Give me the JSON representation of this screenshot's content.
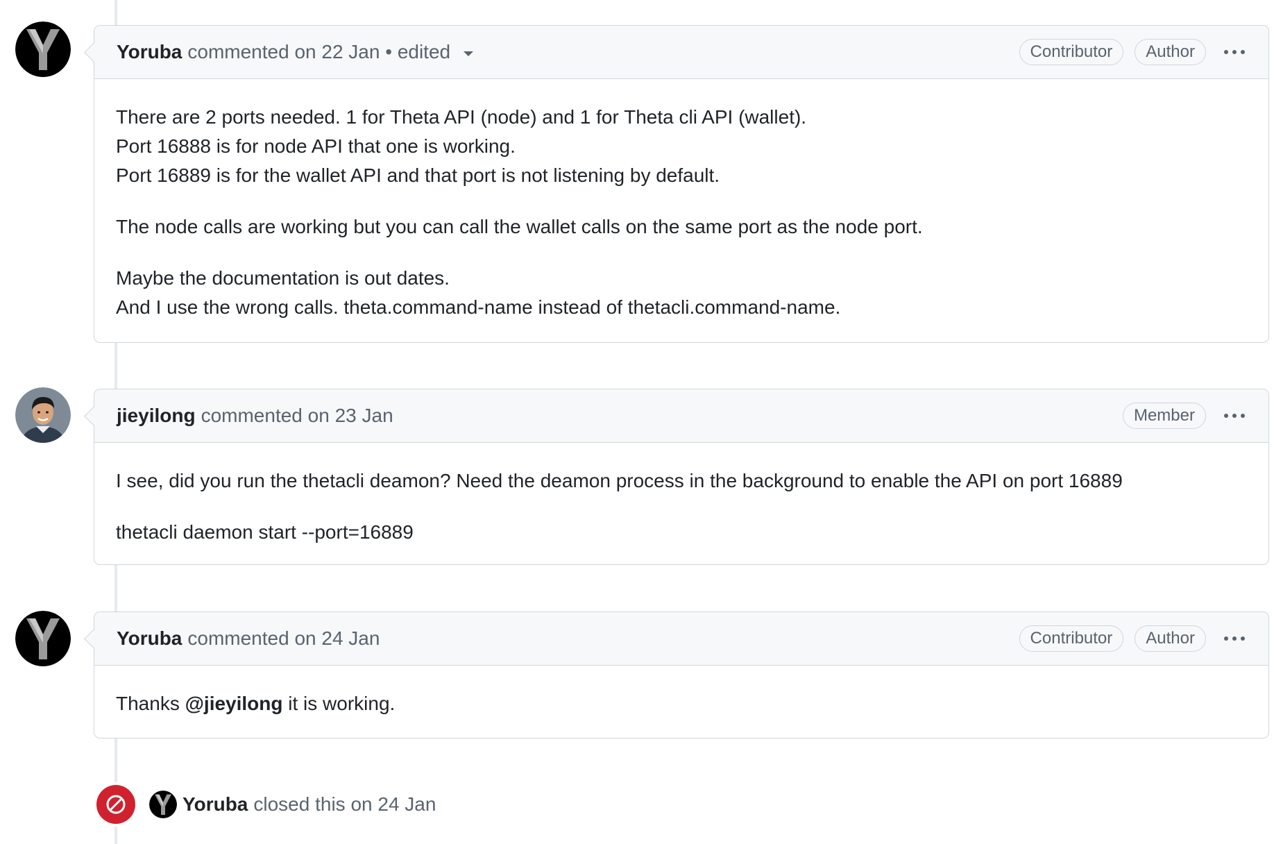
{
  "comments": [
    {
      "author": "Yoruba",
      "meta": "commented on 22 Jan • edited",
      "badges": [
        "Contributor",
        "Author"
      ],
      "avatar_icon": "yoruba-y-logo-icon",
      "paragraphs": [
        [
          "There are 2 ports needed. 1 for Theta API (node) and 1 for Theta cli API (wallet).",
          "Port 16888 is for node API that one is working.",
          "Port 16889 is for the wallet API and that port is not listening by default."
        ],
        [
          "The node calls are working but you can call the wallet calls on the same port as the node port."
        ],
        [
          "Maybe the documentation is out dates.",
          "And I use the wrong calls. theta.command-name instead of thetacli.command-name."
        ]
      ]
    },
    {
      "author": "jieyilong",
      "meta": "commented on 23 Jan",
      "badges": [
        "Member"
      ],
      "avatar_icon": "user-photo-avatar",
      "paragraphs": [
        [
          "I see, did you run the thetacli deamon? Need the deamon process in the background to enable the API on port 16889"
        ],
        [
          "thetacli daemon start --port=16889"
        ]
      ]
    },
    {
      "author": "Yoruba",
      "meta": "commented on 24 Jan",
      "badges": [
        "Contributor",
        "Author"
      ],
      "avatar_icon": "yoruba-y-logo-icon",
      "body_prefix": "Thanks ",
      "body_mention": "@jieyilong",
      "body_suffix": " it is working."
    }
  ],
  "closed_event": {
    "author": "Yoruba",
    "text": "closed this on 24 Jan",
    "icon": "circle-slash-icon",
    "color": "#cf222e"
  },
  "colors": {
    "header_bg": "#f6f8fa",
    "border": "#d0d7de",
    "muted_text": "#59636e",
    "text": "#1f2328"
  }
}
